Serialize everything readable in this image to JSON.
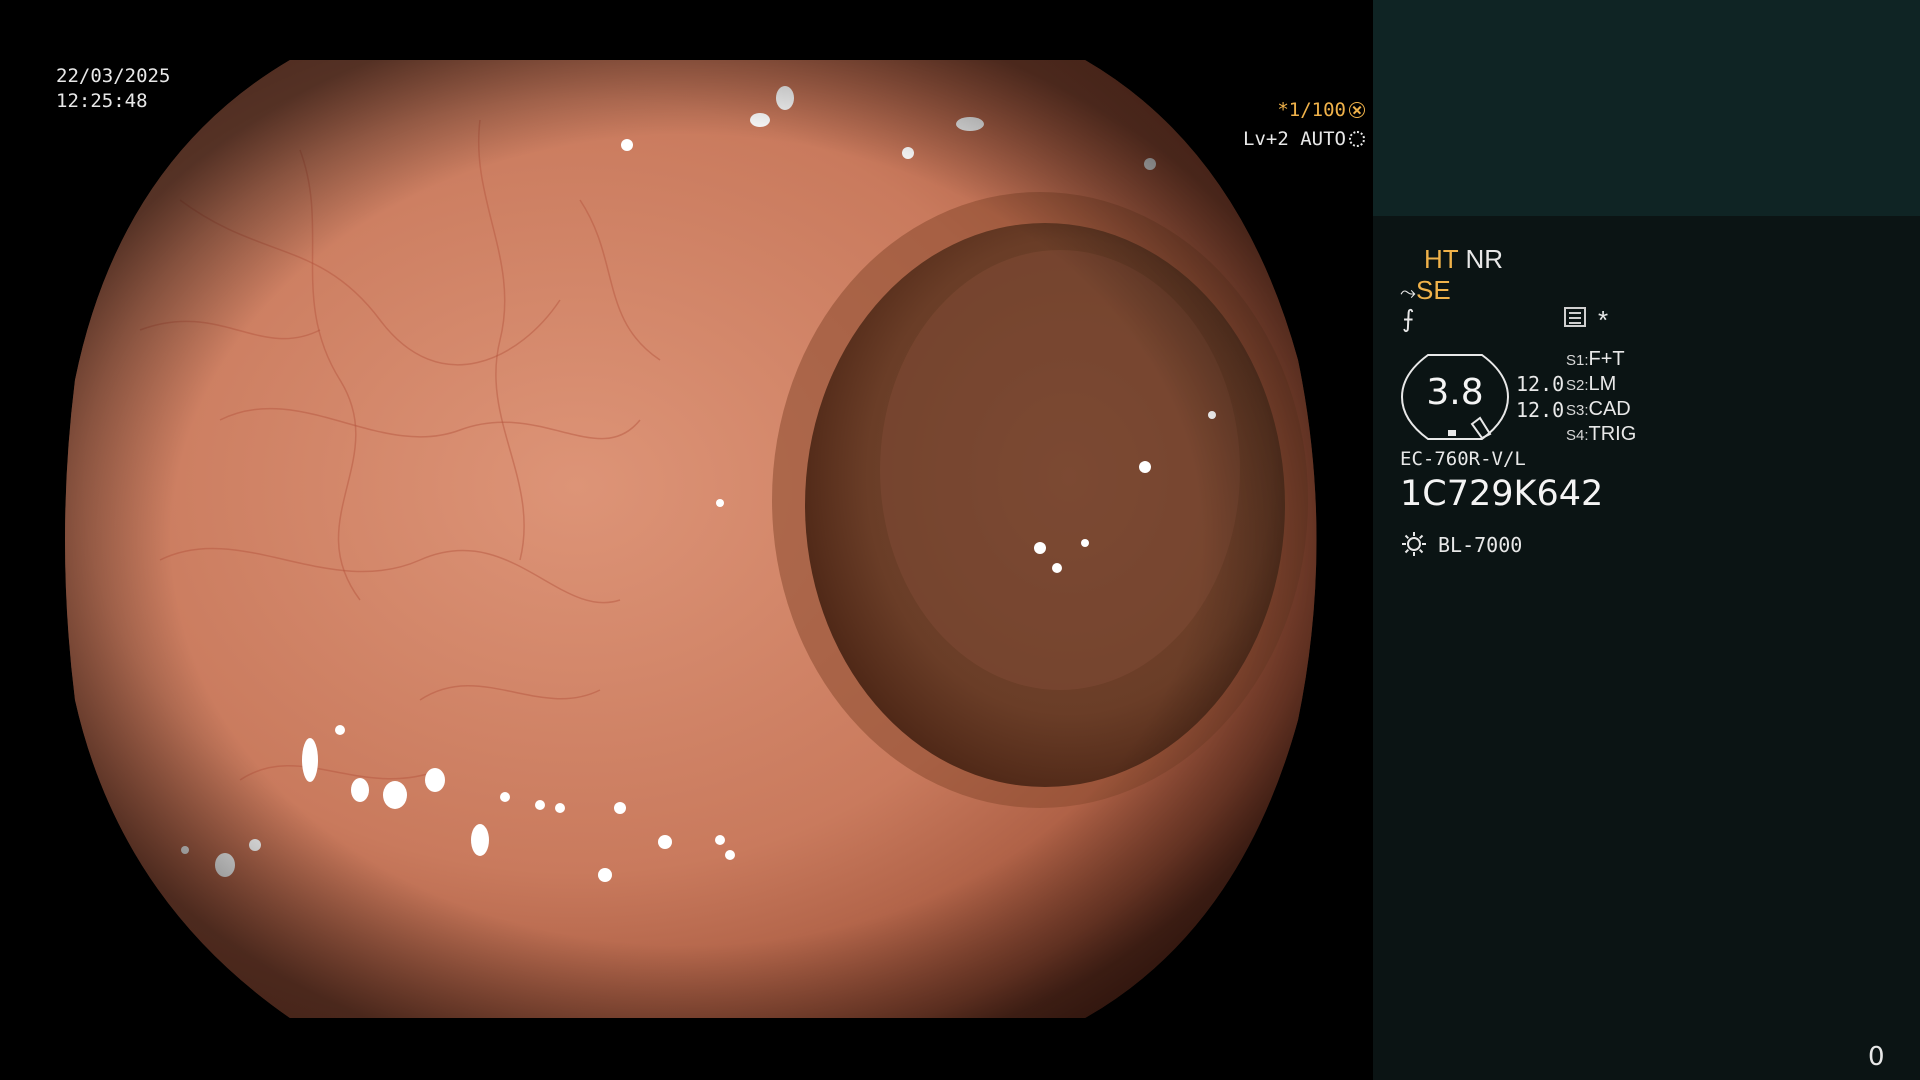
{
  "osd": {
    "date": "22/03/2025",
    "time": "12:25:48",
    "exposure": "*1/100",
    "exposure_icon": "shutter-icon",
    "level": "Lv+2 AUTO",
    "level_icon": "iris-icon"
  },
  "panel": {
    "ht_label": "HT",
    "nr_label": "NR",
    "se_label": "SE",
    "se_icon": "enhance-curve-icon",
    "curve_icon": "gamma-icon",
    "menu_icon": "menu-list-icon",
    "star": "*",
    "gauge_value": "3.8",
    "value_1": "12.0",
    "value_2": "12.0",
    "switches": [
      {
        "key": "S1:",
        "value": "F+T"
      },
      {
        "key": "S2:",
        "value": "LM"
      },
      {
        "key": "S3:",
        "value": "CAD"
      },
      {
        "key": "S4:",
        "value": "TRIG"
      }
    ],
    "scope_model": "EC-760R-V/L",
    "scope_serial": "1C729K642",
    "light_icon": "light-source-icon",
    "light_source": "BL-7000"
  },
  "frame_counter": "0",
  "colors": {
    "accent_orange": "#f0b24a",
    "panel_bg": "#0b1414",
    "panel_top_bg": "#0f2424",
    "mucosa": "#c8745a"
  }
}
